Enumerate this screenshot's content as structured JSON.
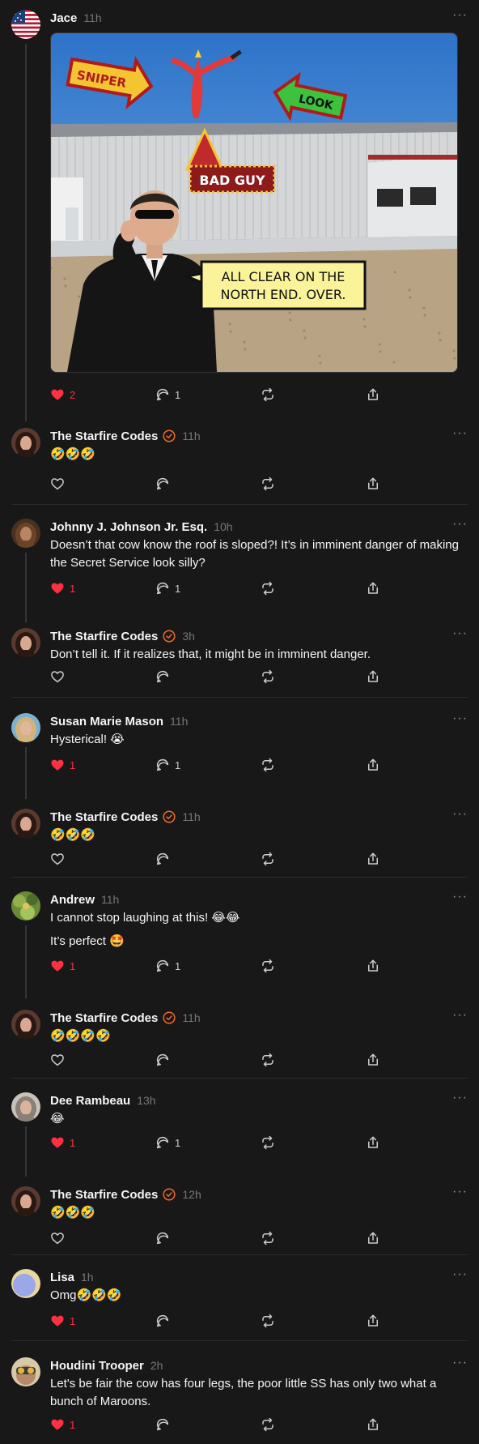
{
  "verified_color": "#f26b1d",
  "like_color": "#ff3040",
  "posts": [
    {
      "author": "Jace",
      "time": "11h",
      "text": [],
      "likes": "2",
      "replies": "1",
      "liked": true,
      "verified": false
    },
    {
      "author": "The Starfire Codes",
      "time": "11h",
      "text": [
        "🤣🤣🤣"
      ],
      "likes": "",
      "replies": "",
      "liked": false,
      "verified": true
    },
    {
      "author": "Johnny J. Johnson Jr. Esq.",
      "time": "10h",
      "text": [
        "Doesn’t that cow know the roof is sloped?! It’s in imminent danger of making the Secret Service look silly?"
      ],
      "likes": "1",
      "replies": "1",
      "liked": true,
      "verified": false
    },
    {
      "author": "The Starfire Codes",
      "time": "3h",
      "text": [
        "Don’t tell it. If it realizes that, it might be in imminent danger."
      ],
      "likes": "",
      "replies": "",
      "liked": false,
      "verified": true
    },
    {
      "author": "Susan Marie Mason",
      "time": "11h",
      "text": [
        "Hysterical! 😭"
      ],
      "likes": "1",
      "replies": "1",
      "liked": true,
      "verified": false
    },
    {
      "author": "The Starfire Codes",
      "time": "11h",
      "text": [
        "🤣🤣🤣"
      ],
      "likes": "",
      "replies": "",
      "liked": false,
      "verified": true
    },
    {
      "author": "Andrew",
      "time": "11h",
      "text": [
        "I cannot stop laughing at this! 😂😂",
        "It’s perfect 🤩"
      ],
      "likes": "1",
      "replies": "1",
      "liked": true,
      "verified": false
    },
    {
      "author": "The Starfire Codes",
      "time": "11h",
      "text": [
        "🤣🤣🤣🤣"
      ],
      "likes": "",
      "replies": "",
      "liked": false,
      "verified": true
    },
    {
      "author": "Dee Rambeau",
      "time": "13h",
      "text": [
        "😂"
      ],
      "likes": "1",
      "replies": "1",
      "liked": true,
      "verified": false
    },
    {
      "author": "The Starfire Codes",
      "time": "12h",
      "text": [
        "🤣🤣🤣"
      ],
      "likes": "",
      "replies": "",
      "liked": false,
      "verified": true
    },
    {
      "author": "Lisa",
      "time": "1h",
      "text": [
        "Omg🤣🤣🤣"
      ],
      "likes": "1",
      "replies": "",
      "liked": true,
      "verified": false
    },
    {
      "author": "Houdini Trooper",
      "time": "2h",
      "text": [
        "Let's be fair the cow has four legs, the poor little SS has only two what a bunch of Maroons."
      ],
      "likes": "1",
      "replies": "",
      "liked": true,
      "verified": false
    }
  ],
  "meme": {
    "sign_sniper": "SNIPER",
    "sign_look": "LOOK",
    "sign_bad_guy": "BAD GUY",
    "speech": [
      "ALL CLEAR ON THE",
      "NORTH END. OVER."
    ]
  }
}
